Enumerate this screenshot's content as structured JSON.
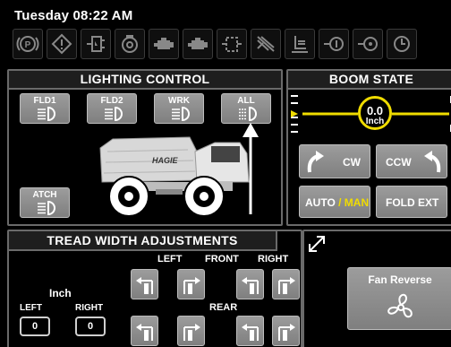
{
  "status": {
    "datetime": "Tuesday 08:22 AM"
  },
  "indicators": [
    {
      "icon": "parking-brake-icon"
    },
    {
      "icon": "warning-icon"
    },
    {
      "icon": "hydraulic-filter-icon"
    },
    {
      "icon": "turbo-icon"
    },
    {
      "icon": "engine-left-icon"
    },
    {
      "icon": "engine-right-icon"
    },
    {
      "icon": "fuel-filter-icon"
    },
    {
      "icon": "air-filter-icon"
    },
    {
      "icon": "seat-icon"
    },
    {
      "icon": "coolant-icon"
    },
    {
      "icon": "fan-status-icon"
    }
  ],
  "lighting": {
    "title": "LIGHTING CONTROL",
    "fld1": "FLD1",
    "fld2": "FLD2",
    "wrk": "WRK",
    "all": "ALL",
    "atch": "ATCH",
    "brand": "HAGIE"
  },
  "boom": {
    "title": "BOOM STATE",
    "value": "0.0",
    "unit": "Inch",
    "cw": "CW",
    "ccw": "CCW",
    "auto": "AUTO",
    "slash": " / ",
    "man": "MAN",
    "fold_ext": "FOLD EXT"
  },
  "tread": {
    "title": "TREAD WIDTH ADJUSTMENTS",
    "left": "LEFT",
    "front": "FRONT",
    "right": "RIGHT",
    "rear": "REAR",
    "unit": "Inch",
    "left_label": "LEFT",
    "right_label": "RIGHT",
    "left_value": "0",
    "right_value": "0"
  },
  "fan": {
    "label": "Fan Reverse"
  },
  "colors": {
    "accent_yellow": "#f0dc00",
    "button_gray": "#8c8c8c",
    "panel_border": "#6a6a6a"
  }
}
